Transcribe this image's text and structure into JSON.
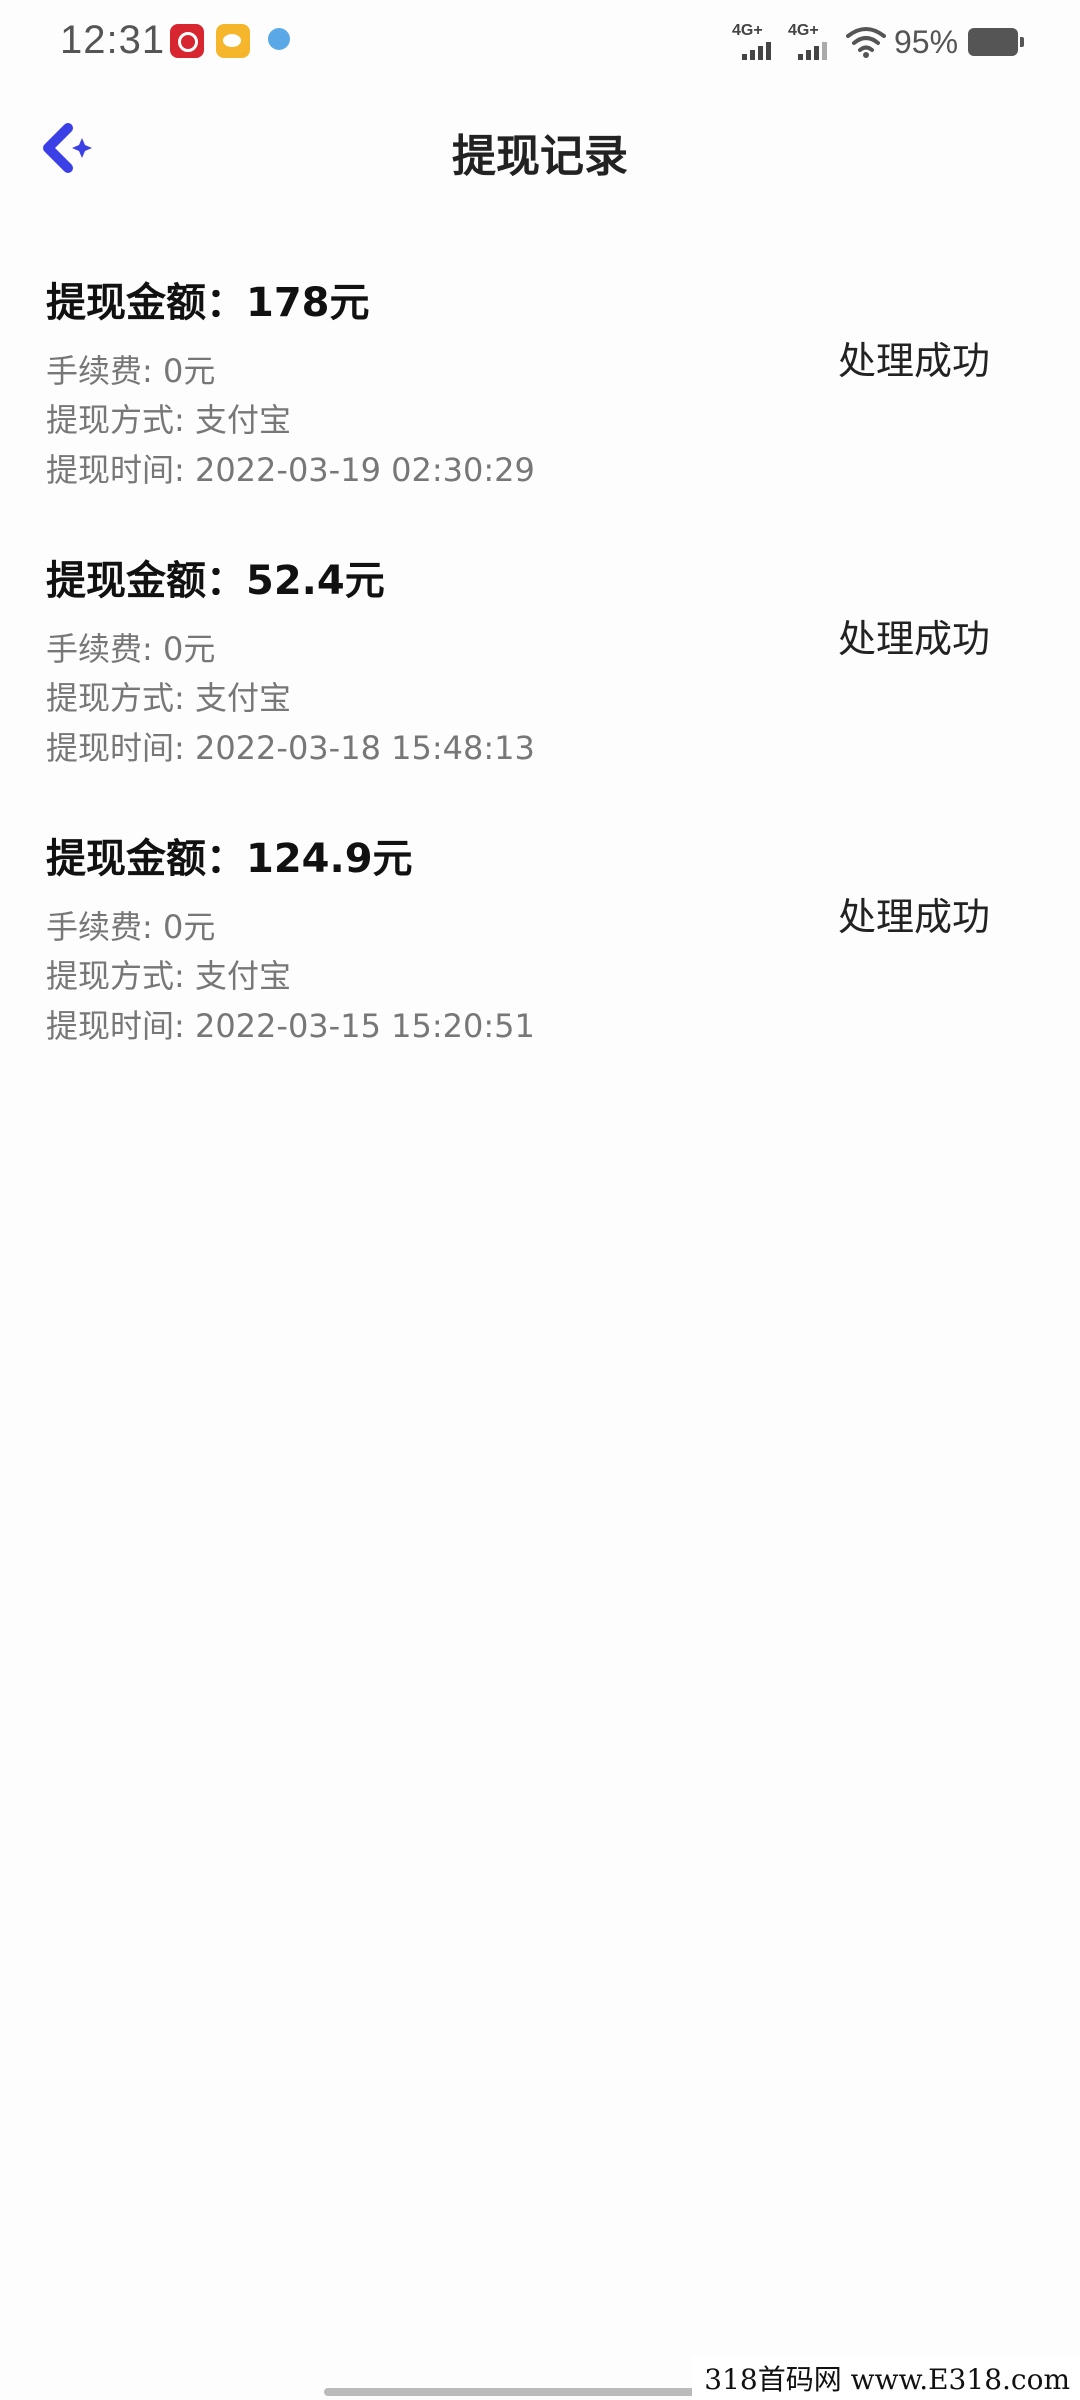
{
  "status_bar": {
    "time": "12:31",
    "notifications": [
      "netease-music-icon",
      "weibo-icon",
      "app-notification-icon"
    ],
    "signal_1": "4G+",
    "signal_2": "4G+",
    "battery": "95%"
  },
  "header": {
    "title": "提现记录",
    "back_icon": "back-arrow-icon",
    "accent_color": "#3b3fe6"
  },
  "records": [
    {
      "amount": "提现金额：178元",
      "fee": "手续费: 0元",
      "method": "提现方式: 支付宝",
      "time": "提现时间: 2022-03-19 02:30:29",
      "status": "处理成功"
    },
    {
      "amount": "提现金额：52.4元",
      "fee": "手续费: 0元",
      "method": "提现方式: 支付宝",
      "time": "提现时间: 2022-03-18 15:48:13",
      "status": "处理成功"
    },
    {
      "amount": "提现金额：124.9元",
      "fee": "手续费: 0元",
      "method": "提现方式: 支付宝",
      "time": "提现时间: 2022-03-15 15:20:51",
      "status": "处理成功"
    }
  ],
  "watermark": "318首码网 www.E318.com"
}
